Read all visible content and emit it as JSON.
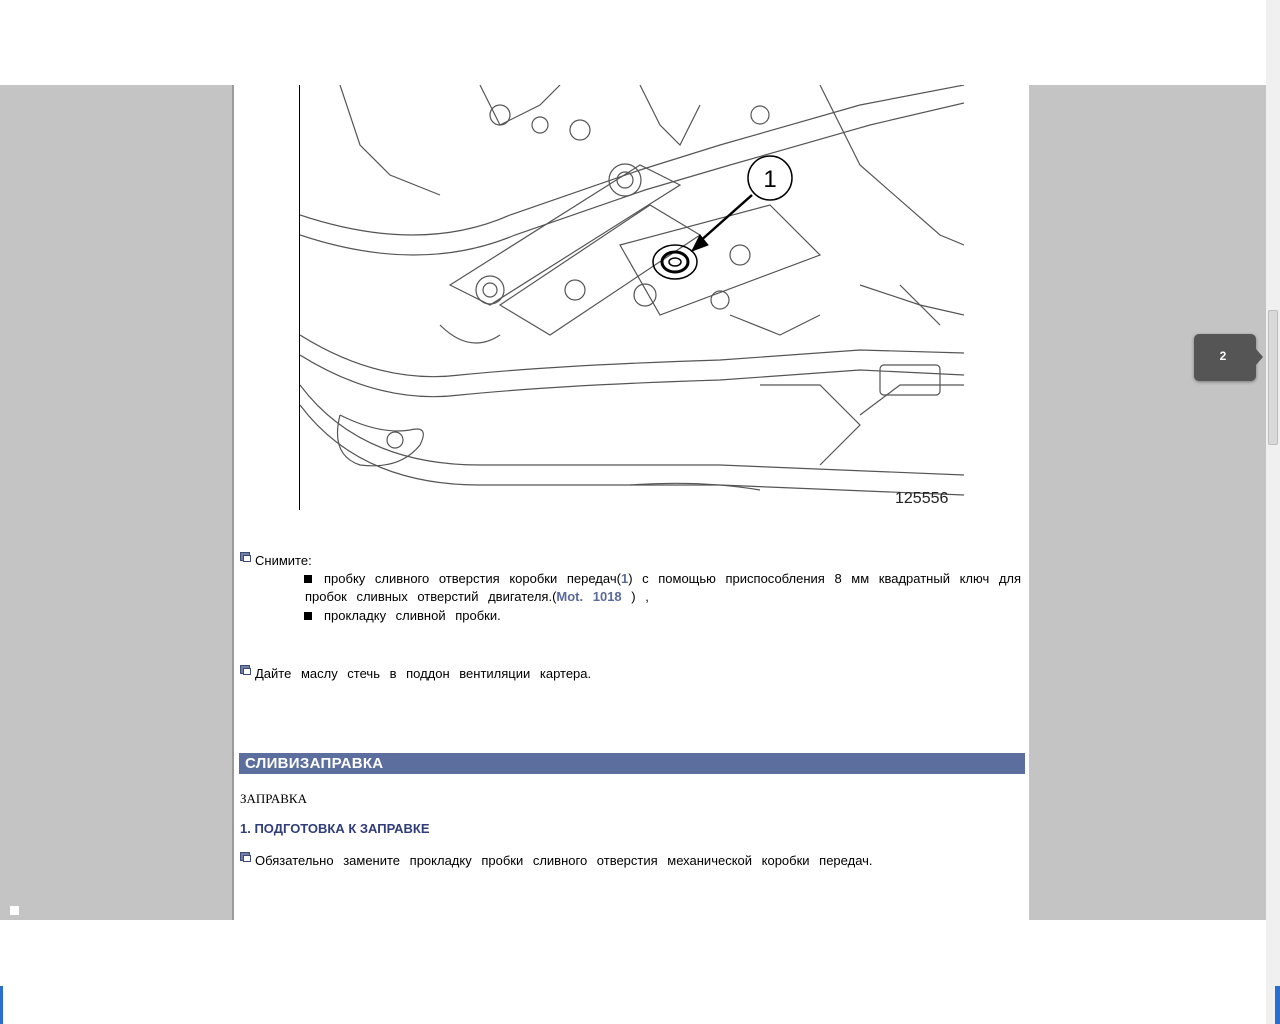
{
  "figure": {
    "callout_number": "1",
    "figure_id": "125556"
  },
  "remove": {
    "intro": "Снимите:",
    "item1_text_before_link": "пробку сливного отверстия коробки передач(",
    "item1_ref": "1",
    "item1_text_after_ref": ") с помощью приспособления 8 мм квадратный ключ для",
    "item1_line2_before_tool": "пробок сливных отверстий двигателя.(",
    "item1_tool": "Mot. 1018",
    "item1_line2_after_tool": " ) ,",
    "item2": "прокладку сливной пробки."
  },
  "drain_instruction": "Дайте маслу стечь в поддон вентиляции картера.",
  "section": {
    "title": "СЛИВИЗАПРАВКА",
    "subtitle": "ЗАПРАВКА",
    "step_heading": "1. ПОДГОТОВКА К ЗАПРАВКЕ",
    "instruction": "Обязательно замените прокладку пробки сливного отверстия механической коробки передач."
  },
  "viewer": {
    "page_indicator": "2"
  },
  "colors": {
    "viewer_background": "#c4c4c4",
    "section_bar": "#5b6e9e",
    "step_heading": "#2f3d7a",
    "link": "#5a6b9c",
    "badge": "#555555"
  }
}
